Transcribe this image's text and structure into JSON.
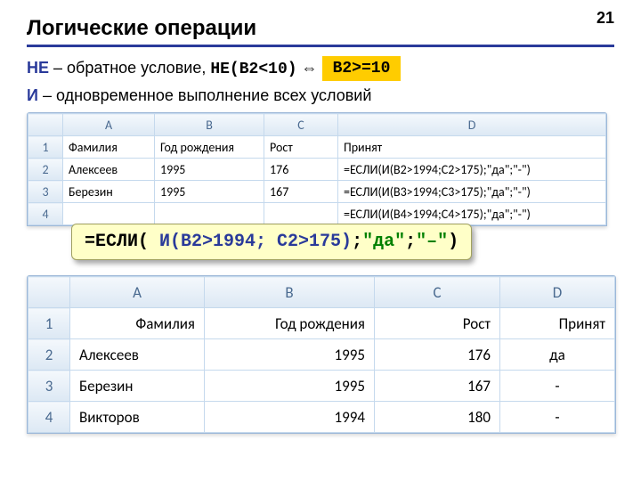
{
  "page_number": "21",
  "title": "Логические операции",
  "line1": {
    "kw": "НЕ",
    "rest": " – обратное условие,   ",
    "code": "НЕ(B2<10)",
    "arrows": "  ⇔  "
  },
  "badge": "B2>=10",
  "line2": {
    "kw": "И",
    "rest": " – одновременное выполнение всех условий"
  },
  "table1": {
    "cols": [
      "A",
      "B",
      "C",
      "D"
    ],
    "headers": [
      "Фамилия",
      "Год рождения",
      "Рост",
      "Принят"
    ],
    "rows": [
      [
        "Алексеев",
        "1995",
        "176",
        "=ЕСЛИ(И(B2>1994;C2>175);\"да\";\"-\")"
      ],
      [
        "Березин",
        "1995",
        "167",
        "=ЕСЛИ(И(B3>1994;C3>175);\"да\";\"-\")"
      ],
      [
        "",
        "",
        "",
        "=ЕСЛИ(И(B4>1994;C4>175);\"да\";\"-\")"
      ]
    ]
  },
  "formula": {
    "p1": "=ЕСЛИ(",
    "p2": " И(B2>1994; C2>175)",
    "p3": ";",
    "p4": "\"да\"",
    "p5": ";",
    "p6": "\"–\"",
    "p7": ")"
  },
  "table2": {
    "cols": [
      "A",
      "B",
      "C",
      "D"
    ],
    "headers": [
      "Фамилия",
      "Год рождения",
      "Рост",
      "Принят"
    ],
    "rows": [
      [
        "Алексеев",
        "1995",
        "176",
        "да"
      ],
      [
        "Березин",
        "1995",
        "167",
        "-"
      ],
      [
        "Викторов",
        "1994",
        "180",
        "-"
      ]
    ]
  }
}
